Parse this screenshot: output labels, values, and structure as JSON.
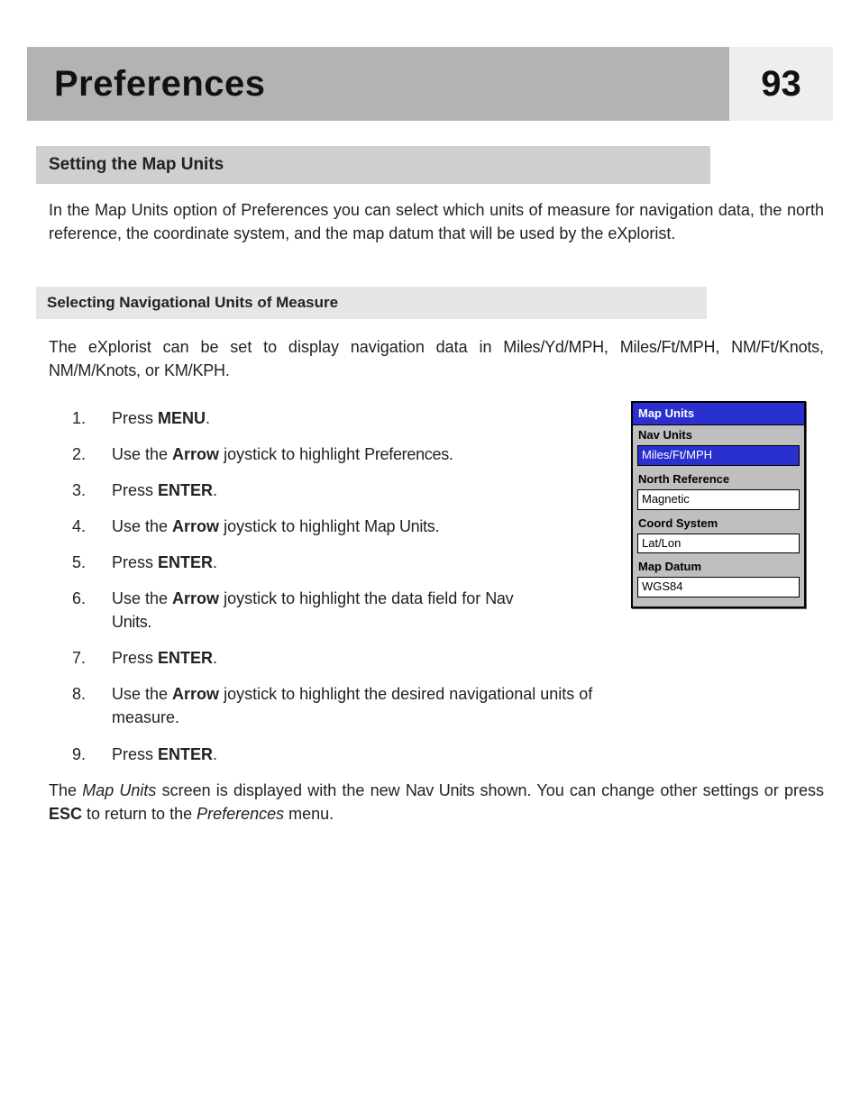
{
  "header": {
    "title": "Preferences",
    "page": "93"
  },
  "section": {
    "title": "Setting the Map Units"
  },
  "intro": "In the Map Units option of Preferences you can select which units of measure for navigation data, the north reference, the coordinate system, and the map datum that will be used by the eXplorist.",
  "subsection": {
    "title": "Selecting Navigational Units of Measure"
  },
  "lead": {
    "pre": "The eXplorist can be set to display navigation data in ",
    "opt1": "Miles/Yd/MPH",
    "sep1": ", ",
    "opt2": "Miles/Ft/MPH",
    "sep2": ", ",
    "opt3": "NM/Ft/Knots",
    "sep3": ", ",
    "opt4": "NM/M/Knots",
    "sep4": ", or ",
    "opt5": "KM/KPH",
    "post": "."
  },
  "steps": [
    {
      "pre": "Press ",
      "b": "MENU",
      "post": "."
    },
    {
      "pre": "Use the ",
      "b": "Arrow",
      "mid": " joystick to highlight ",
      "term": "Preferences",
      "post": "."
    },
    {
      "pre": "Press ",
      "b": "ENTER",
      "post": "."
    },
    {
      "pre": "Use the ",
      "b": "Arrow",
      "mid": " joystick to highlight ",
      "term": "Map Units",
      "post": "."
    },
    {
      "pre": "Press ",
      "b": "ENTER",
      "post": "."
    },
    {
      "pre": "Use the ",
      "b": "Arrow",
      "mid": " joystick to highlight the data field for ",
      "term": "Nav Units",
      "post": "."
    },
    {
      "pre": "Press ",
      "b": "ENTER",
      "post": "."
    },
    {
      "pre": "Use the ",
      "b": "Arrow",
      "mid": " joystick to highlight the desired navigational units of measure.",
      "term": "",
      "post": ""
    },
    {
      "pre": "Press ",
      "b": "ENTER",
      "post": "."
    }
  ],
  "closing": {
    "a": "The ",
    "i1": "Map Units",
    "b": " screen is displayed with the new ",
    "t": "Nav Units",
    "c": " shown.  You can change other settings or press ",
    "esc": "ESC",
    "d": " to return to the ",
    "i2": "Preferences",
    "e": " menu."
  },
  "device": {
    "title": "Map  Units",
    "rows": [
      {
        "label": "Nav Units",
        "value": "Miles/Ft/MPH",
        "selected": true
      },
      {
        "label": "North Reference",
        "value": "Magnetic",
        "selected": false
      },
      {
        "label": "Coord System",
        "value": "Lat/Lon",
        "selected": false
      },
      {
        "label": "Map Datum",
        "value": "WGS84",
        "selected": false
      }
    ]
  }
}
